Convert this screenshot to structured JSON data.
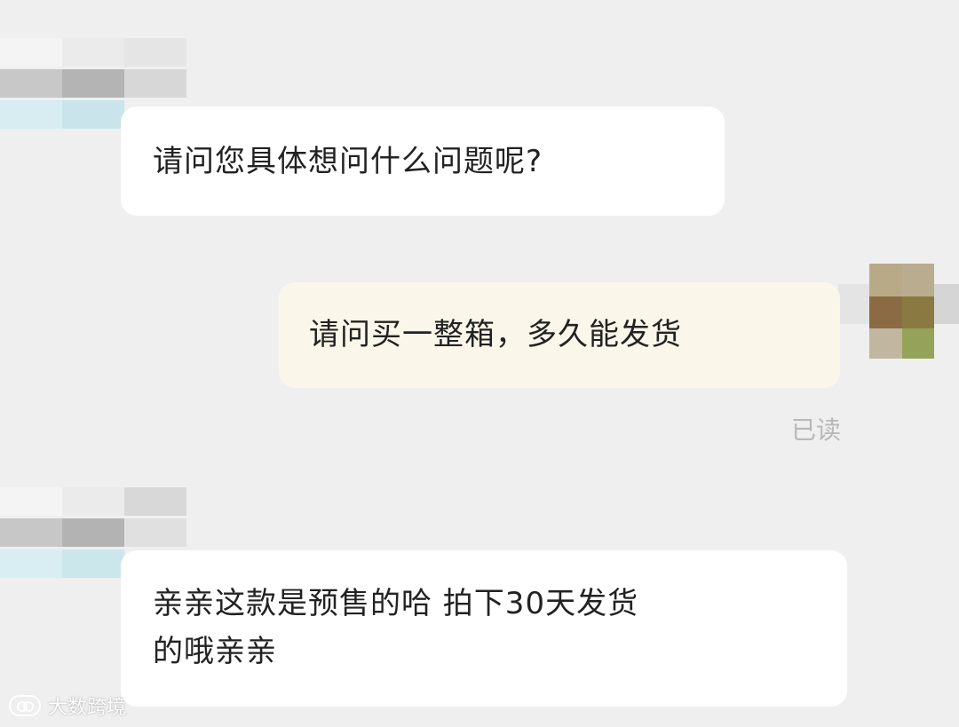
{
  "messages": [
    {
      "text": "请问您具体想问什么问题呢?"
    },
    {
      "text": "请问买一整箱，多久能发货"
    },
    {
      "text": "亲亲这款是预售的哈 拍下30天发货\n的哦亲亲"
    }
  ],
  "status": {
    "read_label": "已读"
  },
  "watermark": {
    "text": "大数跨境"
  }
}
